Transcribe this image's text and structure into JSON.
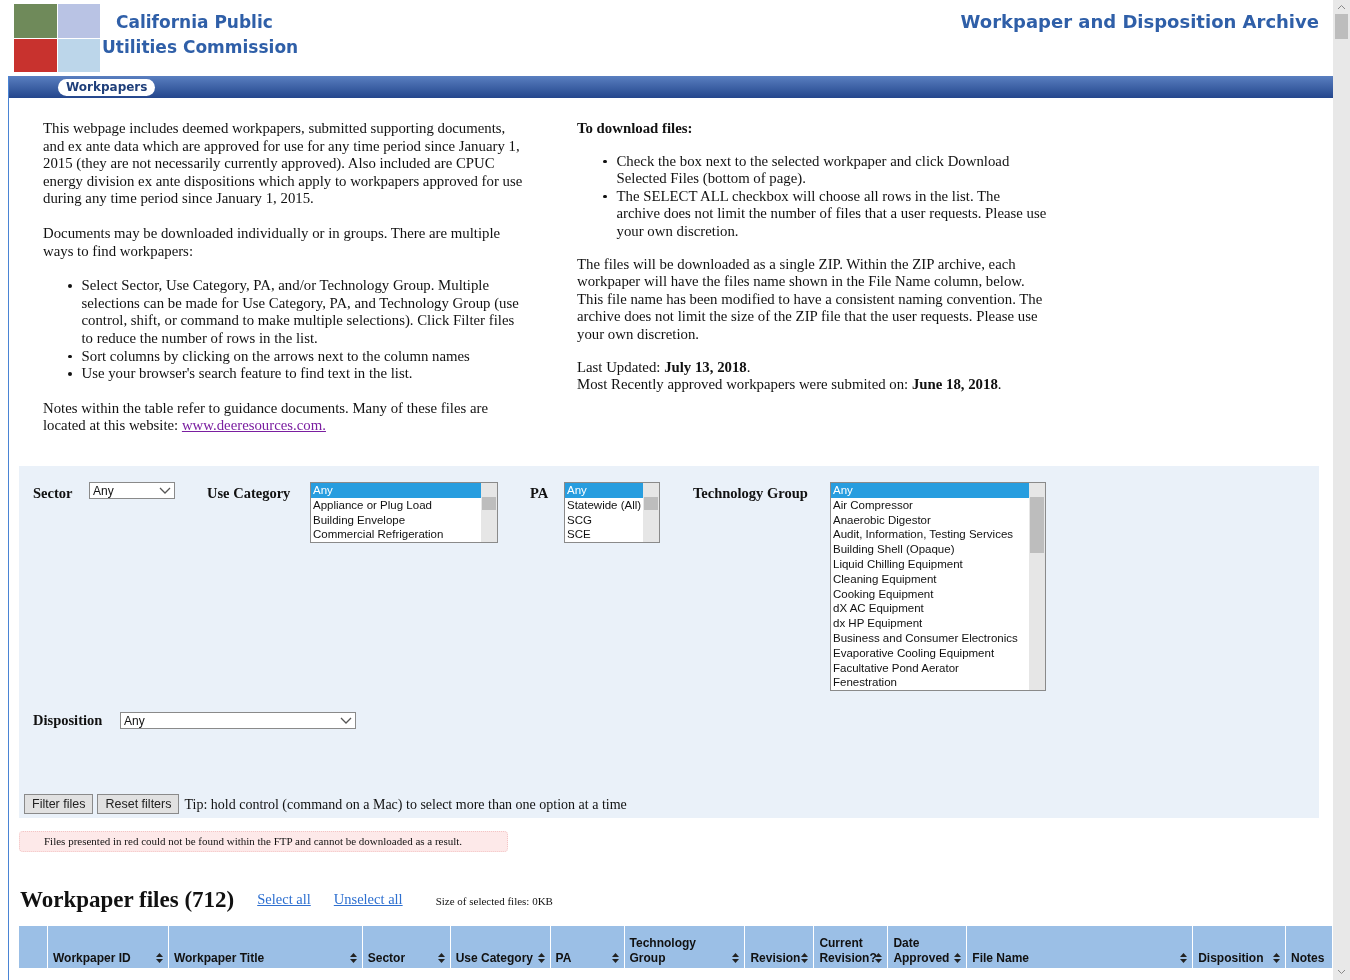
{
  "header": {
    "org_name_lines": [
      "California Public",
      "Utilities Commission"
    ],
    "archive_title": "Workpaper and Disposition Archive",
    "nav_tab": {
      "label": "Workpapers",
      "selected": true
    }
  },
  "intro": {
    "left": {
      "paragraphs": [
        "This webpage includes deemed workpapers, submitted supporting documents, and ex ante data which are approved for use for any time period since January 1, 2015 (they are not necessarily currently approved). Also included are CPUC energy division ex ante dispositions which apply to workpapers approved for use during any time period since January 1, 2015.",
        "Documents may be downloaded individually or in groups. There are multiple ways to find workpapers:"
      ],
      "bullets": [
        "Select Sector, Use Category, PA, and/or Technology Group. Multiple selections can be made for Use Category, PA, and Technology Group (use control, shift, or command to make multiple selections). Click Filter files to reduce the number of rows in the list.",
        "Sort columns by clicking on the arrows next to the column names",
        "Use your browser's search feature to find text in the list."
      ],
      "notes_text": "Notes within the table refer to guidance documents. Many of these files are located at this website: ",
      "notes_link": "www.deeresources.com."
    },
    "right": {
      "heading": "To download files:",
      "bullets": [
        "Check the box next to the selected workpaper and click Download Selected Files (bottom of page).",
        "The SELECT ALL checkbox will choose all rows in the list. The archive does not limit the number of files that a user requests. Please use your own discretion."
      ],
      "paragraph": "The files will be downloaded as a single ZIP. Within the ZIP archive, each workpaper will have the files name shown in the File Name column, below. This file name has been modified to have a consistent naming convention. The archive does not limit the size of the ZIP file that the user requests. Please use your own discretion.",
      "updates": [
        "Last Updated: **July 13, 2018**.",
        "Most Recently approved workpapers were submited on: **June 18, 2018**."
      ]
    }
  },
  "filters": {
    "sector": {
      "label": "Sector",
      "value": "Any"
    },
    "use_category": {
      "label": "Use Category",
      "options": [
        {
          "label": "Any",
          "selected": true
        },
        {
          "label": "Appliance or Plug Load",
          "selected": false
        },
        {
          "label": "Building Envelope",
          "selected": false
        },
        {
          "label": "Commercial Refrigeration",
          "selected": false
        }
      ]
    },
    "pa": {
      "label": "PA",
      "options": [
        {
          "label": "Any",
          "selected": true
        },
        {
          "label": "Statewide (All)",
          "selected": false
        },
        {
          "label": "SCG",
          "selected": false
        },
        {
          "label": "SCE",
          "selected": false
        }
      ]
    },
    "technology_group": {
      "label": "Technology Group",
      "options": [
        {
          "label": "Any",
          "selected": true
        },
        {
          "label": "Air Compressor",
          "selected": false
        },
        {
          "label": "Anaerobic Digestor",
          "selected": false
        },
        {
          "label": "Audit, Information, Testing Services",
          "selected": false
        },
        {
          "label": "Building Shell (Opaque)",
          "selected": false
        },
        {
          "label": "Liquid Chilling Equipment",
          "selected": false
        },
        {
          "label": "Cleaning Equipment",
          "selected": false
        },
        {
          "label": "Cooking Equipment",
          "selected": false
        },
        {
          "label": "dX AC Equipment",
          "selected": false
        },
        {
          "label": "dx HP Equipment",
          "selected": false
        },
        {
          "label": "Business and Consumer Electronics",
          "selected": false
        },
        {
          "label": "Evaporative Cooling Equipment",
          "selected": false
        },
        {
          "label": "Facultative Pond Aerator",
          "selected": false
        },
        {
          "label": "Fenestration",
          "selected": false
        }
      ]
    },
    "disposition": {
      "label": "Disposition",
      "value": "Any"
    },
    "buttons": [
      "Filter files",
      "Reset filters"
    ],
    "tip": "Tip: hold control (command on a Mac) to select more than one option at a time"
  },
  "notice": "Files presented in red could not be found within the FTP and cannot be downloaded as a result.",
  "files": {
    "title": "Workpaper files (712)",
    "select_all": "Select all",
    "unselect_all": "Unselect all",
    "selected_size": "Size of selected files: 0KB"
  },
  "table": {
    "columns": [
      {
        "sortable": false
      },
      {
        "label": "Workpaper ID",
        "sortable": true
      },
      {
        "label": "Workpaper Title",
        "sortable": true
      },
      {
        "label": "Sector",
        "sortable": true
      },
      {
        "label": "Use Category",
        "sortable": true
      },
      {
        "label": "PA",
        "sortable": true
      },
      {
        "label": "Technology Group",
        "sortable": true
      },
      {
        "label": "Revision",
        "sortable": true
      },
      {
        "label": "Current Revision?",
        "sortable": true
      },
      {
        "label": "Date Approved",
        "sortable": true
      },
      {
        "label": "File Name",
        "sortable": true
      },
      {
        "label": "Disposition",
        "sortable": true
      },
      {
        "label": "Notes",
        "sortable": false
      }
    ]
  }
}
